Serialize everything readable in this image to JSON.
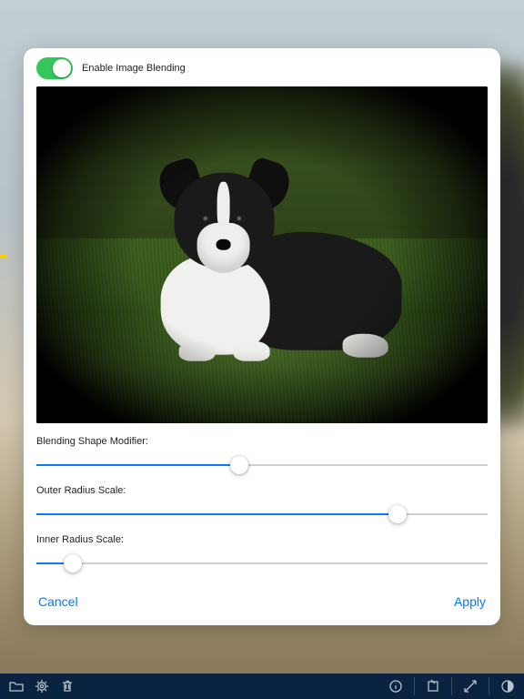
{
  "blending": {
    "toggle_label": "Enable Image Blending",
    "toggle_on": true
  },
  "sliders": {
    "shape": {
      "label": "Blending Shape Modifier:",
      "value": 45
    },
    "outer": {
      "label": "Outer Radius Scale:",
      "value": 80
    },
    "inner": {
      "label": "Inner Radius Scale:",
      "value": 8
    }
  },
  "actions": {
    "cancel": "Cancel",
    "apply": "Apply"
  },
  "toolbar": {
    "folder": "folder",
    "gear": "settings",
    "trash": "trash",
    "info": "info",
    "crop": "crop",
    "expand": "expand",
    "contrast": "contrast"
  }
}
